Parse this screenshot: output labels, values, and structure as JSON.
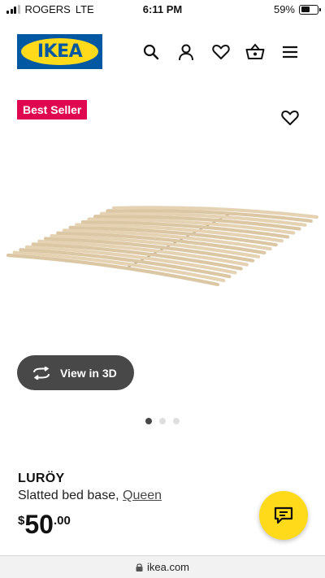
{
  "status_bar": {
    "carrier": "ROGERS",
    "network": "LTE",
    "time": "6:11 PM",
    "battery_percent_text": "59%",
    "battery_level": 0.59
  },
  "header": {
    "logo_text": "IKEA",
    "icons": [
      "search-icon",
      "profile-icon",
      "heart-icon",
      "basket-icon",
      "menu-icon"
    ]
  },
  "badge": {
    "label": "Best Seller"
  },
  "gallery": {
    "view3d_label": "View in 3D",
    "dot_count": 3,
    "active_index": 0
  },
  "product": {
    "name": "LURÖY",
    "description": "Slatted bed base,",
    "size_link": "Queen",
    "price": {
      "currency": "$",
      "integer": "50",
      "decimal": ".00"
    }
  },
  "address_bar": {
    "url": "ikea.com"
  },
  "colors": {
    "brand_blue": "#0058a3",
    "brand_yellow": "#ffda1a",
    "badge_red": "#e00751",
    "button_dark": "#484848"
  }
}
